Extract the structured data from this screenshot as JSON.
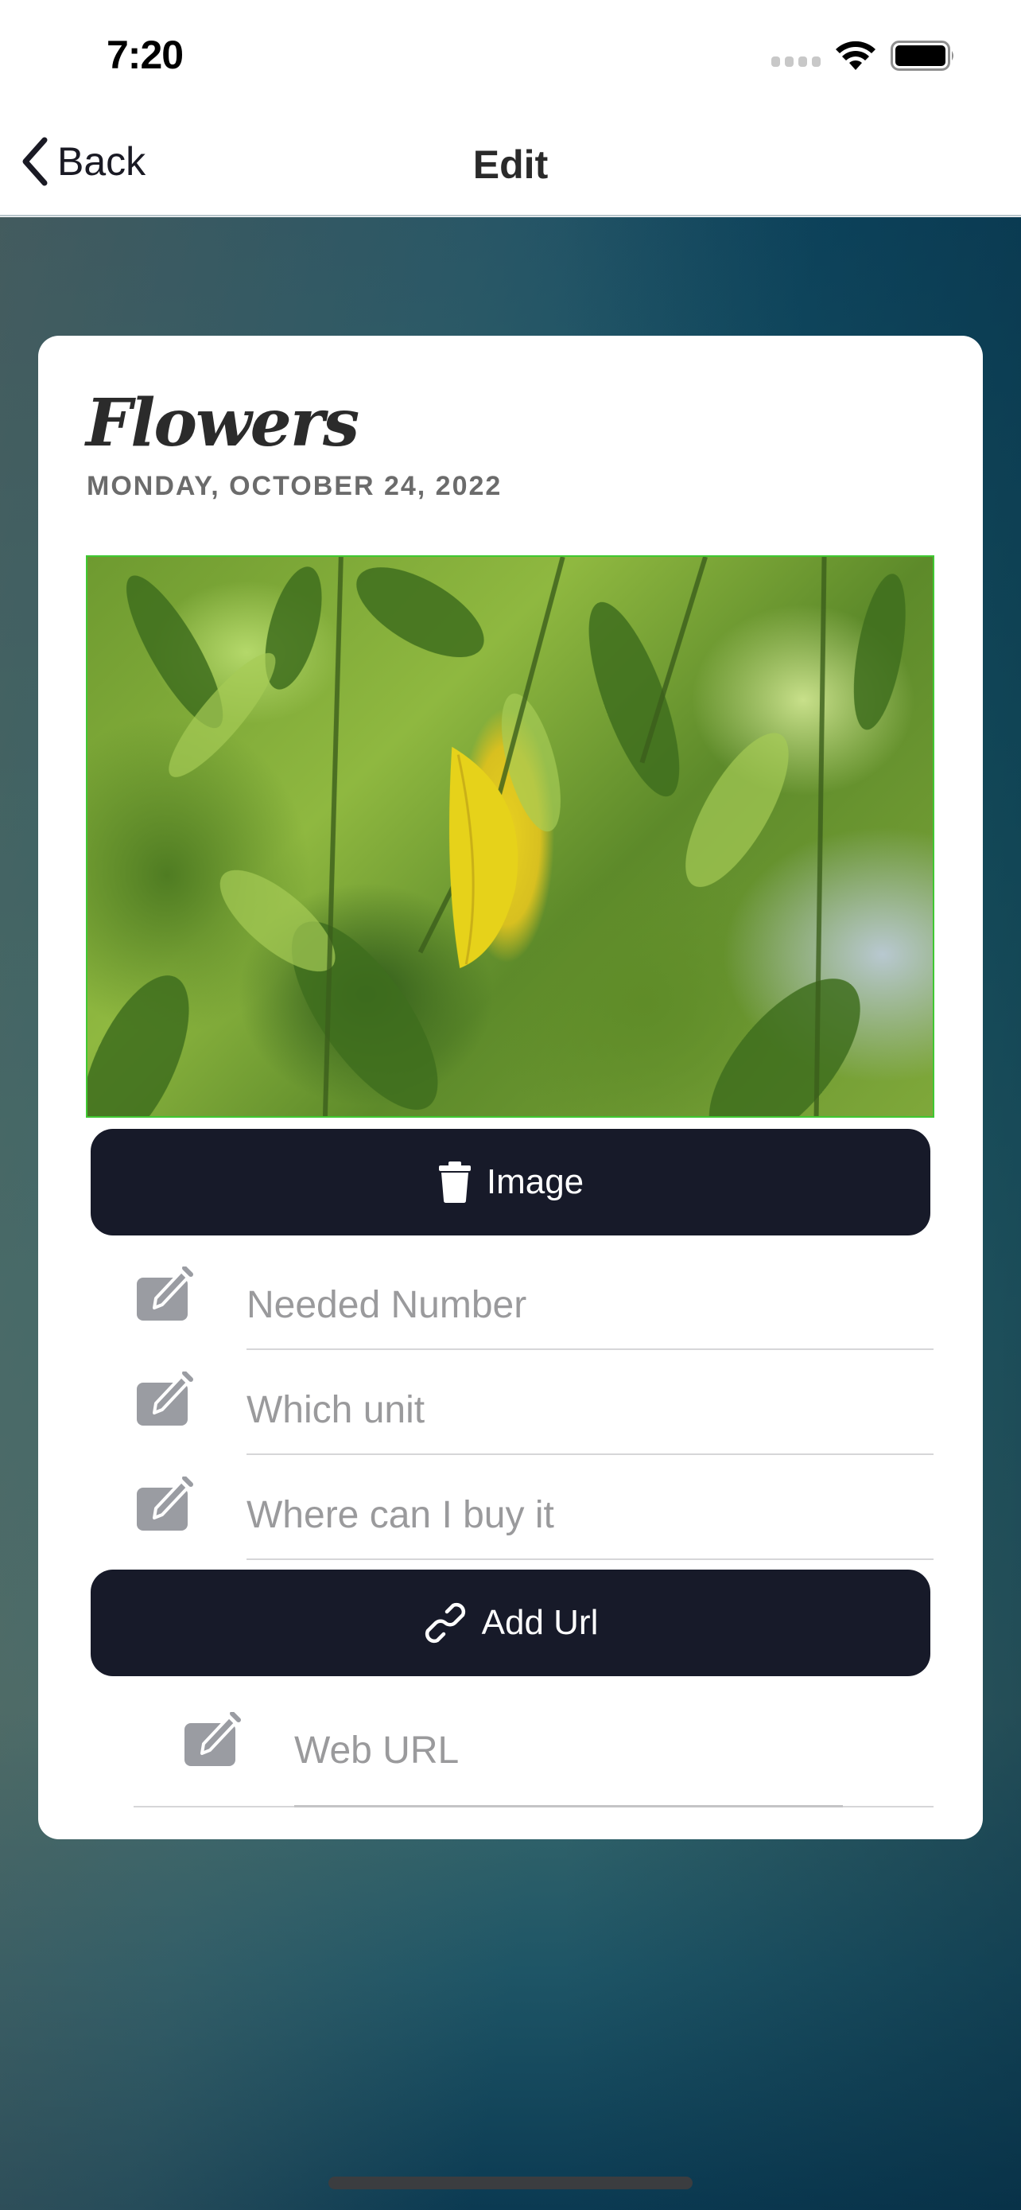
{
  "status_bar": {
    "time": "7:20",
    "icons": [
      "signal-icon",
      "wifi-icon",
      "battery-icon"
    ]
  },
  "nav": {
    "back_label": "Back",
    "title": "Edit"
  },
  "card": {
    "title": "Flowers",
    "date": "MONDAY, OCTOBER 24, 2022",
    "photo_alt": "Green plant leaves with one yellow leaf",
    "delete_image_button": {
      "icon": "trash-icon",
      "label": "Image"
    },
    "fields": [
      {
        "icon": "edit-icon",
        "placeholder": "Needed Number",
        "value": ""
      },
      {
        "icon": "edit-icon",
        "placeholder": "Which unit",
        "value": ""
      },
      {
        "icon": "edit-icon",
        "placeholder": "Where can I buy it",
        "value": ""
      }
    ],
    "add_url_button": {
      "icon": "link-icon",
      "label": "Add Url"
    },
    "url_field": {
      "icon": "edit-icon",
      "placeholder": "Web URL",
      "value": ""
    }
  },
  "colors": {
    "button_bg": "#171a29",
    "placeholder": "#9a9a9c",
    "icon_gray": "#9a9ca2",
    "photo_border": "#3fc832"
  }
}
